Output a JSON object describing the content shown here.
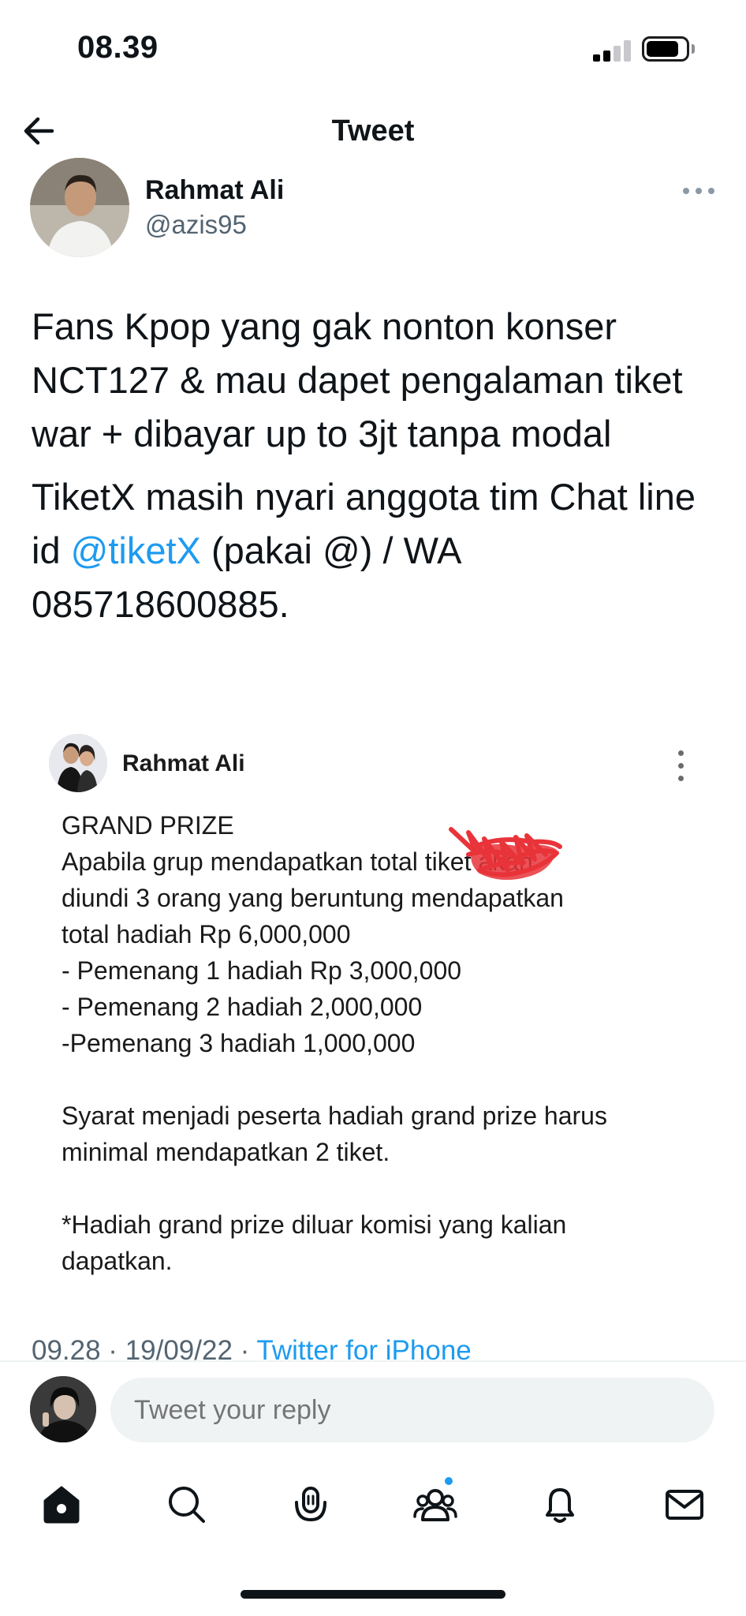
{
  "status_bar": {
    "time": "08.39",
    "icons": [
      "cellular-signal-icon",
      "battery-icon"
    ]
  },
  "header": {
    "title": "Tweet",
    "back_icon": "arrow-left-icon"
  },
  "tweet": {
    "author_name": "Rahmat Ali",
    "author_handle": "@azis95",
    "paragraph1": "Fans Kpop yang gak nonton konser NCT127 & mau dapet pengalaman tiket war + dibayar up to 3jt tanpa modal",
    "paragraph2_before": "TiketX masih nyari anggota tim Chat line id ",
    "mention": "@tiketX",
    "paragraph2_after": " (pakai @) / WA 085718600885.",
    "meta_time": "09.28 · 19/09/22 · ",
    "meta_source": "Twitter for iPhone"
  },
  "embedded_post": {
    "author_name": "Rahmat Ali",
    "body": "GRAND PRIZE\nApabila grup mendapatkan total       tiket akan\ndiundi 3 orang yang beruntung mendapatkan\ntotal hadiah Rp 6,000,000\n- Pemenang 1 hadiah Rp 3,000,000\n- Pemenang 2 hadiah 2,000,000\n-Pemenang 3 hadiah 1,000,000\n\nSyarat menjadi peserta hadiah grand prize harus\nminimal mendapatkan 2 tiket.\n\n*Hadiah grand prize diluar komisi yang kalian\ndapatkan.",
    "redaction_color": "#e8343a"
  },
  "reply": {
    "placeholder": "Tweet your reply"
  },
  "tab_bar": {
    "items": [
      "home-icon",
      "search-icon",
      "spaces-icon",
      "communities-icon",
      "notifications-icon",
      "messages-icon"
    ],
    "badge_color": "#1d9bf0"
  },
  "colors": {
    "accent": "#1d9bf0",
    "secondary_text": "#536471",
    "primary_text": "#0f1419"
  }
}
